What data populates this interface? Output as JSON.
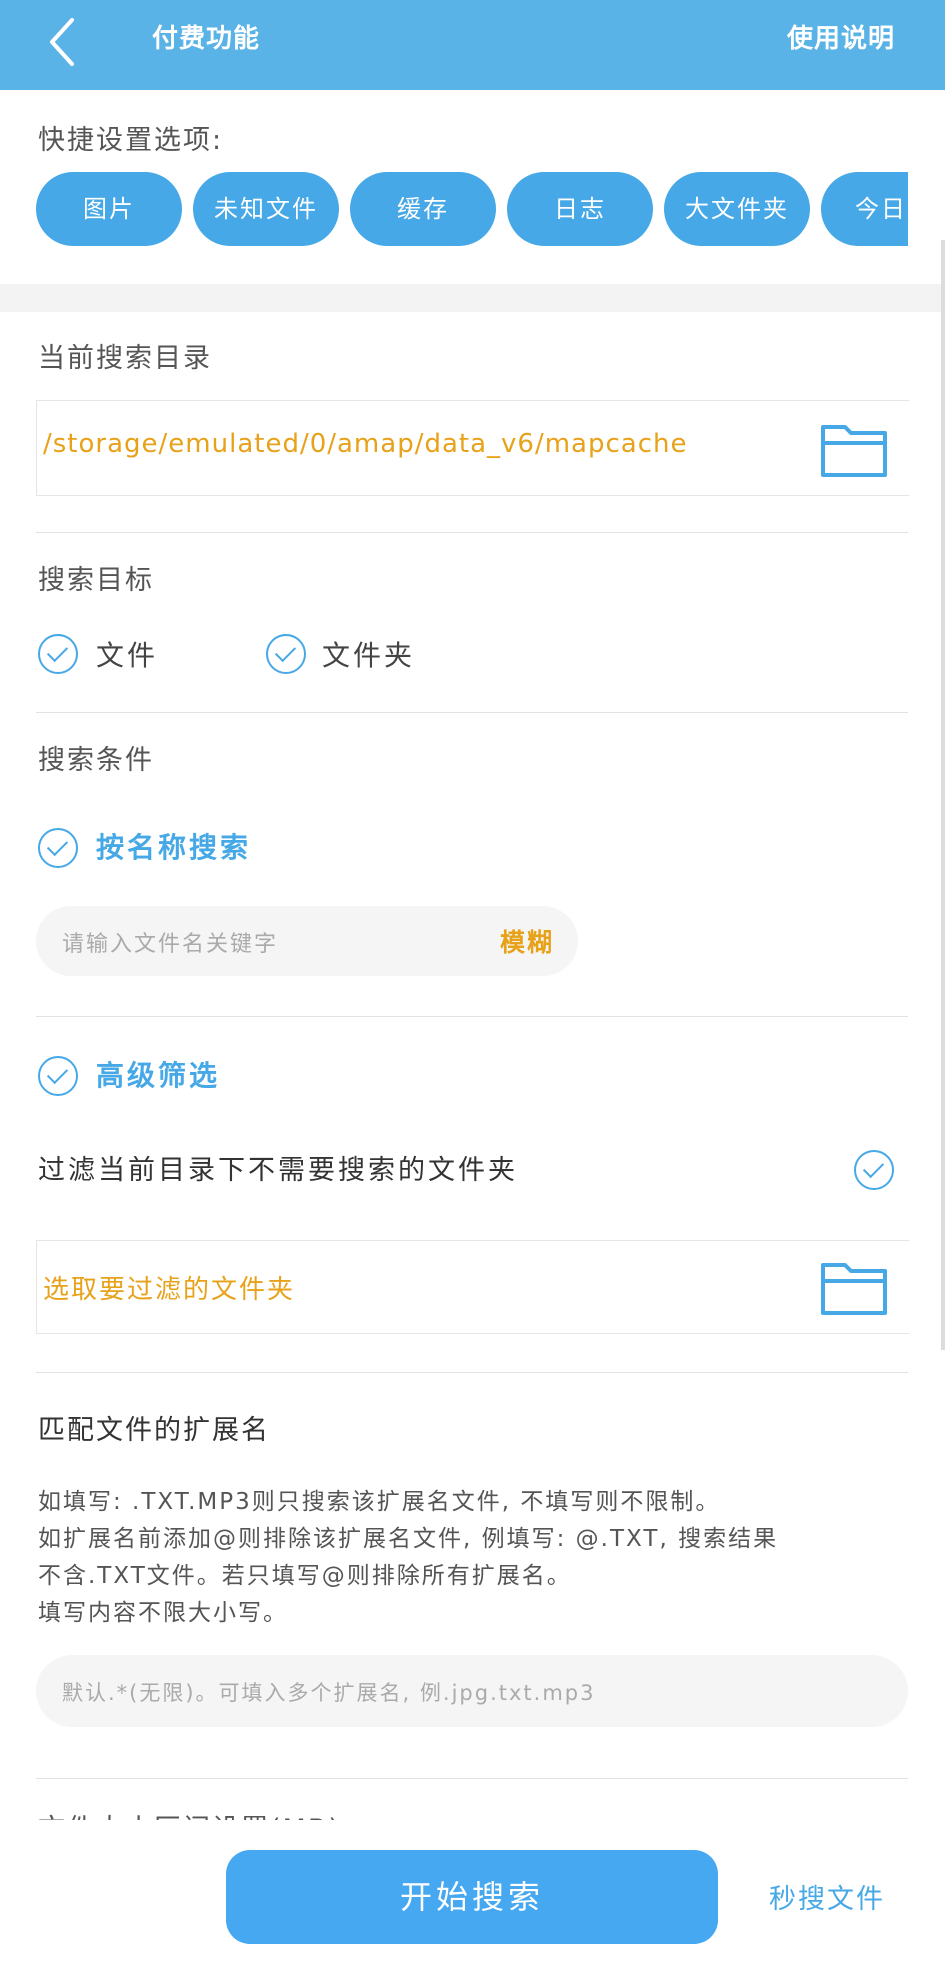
{
  "header": {
    "title": "付费功能",
    "help_label": "使用说明"
  },
  "quick_settings": {
    "title": "快捷设置选项:",
    "chips": [
      "图片",
      "未知文件",
      "缓存",
      "日志",
      "大文件夹",
      "今日文"
    ]
  },
  "search_dir": {
    "title": "当前搜索目录",
    "path": "/storage/emulated/0/amap/data_v6/mapcache"
  },
  "search_target": {
    "title": "搜索目标",
    "options": [
      {
        "label": "文件",
        "checked": true
      },
      {
        "label": "文件夹",
        "checked": true
      }
    ]
  },
  "search_conditions": {
    "title": "搜索条件",
    "by_name": {
      "label": "按名称搜索",
      "checked": true
    },
    "name_input_placeholder": "请输入文件名关键字",
    "fuzzy_label": "模糊"
  },
  "advanced_filter": {
    "label": "高级筛选",
    "checked": true,
    "filter_folders_label": "过滤当前目录下不需要搜索的文件夹",
    "filter_folders_checked": true,
    "pick_folders_label": "选取要过滤的文件夹"
  },
  "extension": {
    "title": "匹配文件的扩展名",
    "description": [
      "如填写: .TXT.MP3则只搜索该扩展名文件, 不填写则不限制。",
      "如扩展名前添加@则排除该扩展名文件, 例填写: @.TXT, 搜索结果",
      "不含.TXT文件。若只填写@则排除所有扩展名。",
      "填写内容不限大小写。"
    ],
    "input_placeholder": "默认.*(无限)。可填入多个扩展名, 例.jpg.txt.mp3"
  },
  "next_section_title": "文件大小区间设置(MB)",
  "footer": {
    "start_label": "开始搜索",
    "quick_search_label": "秒搜文件"
  },
  "colors": {
    "header_bg": "#5ab3e6",
    "accent": "#46a8e6",
    "highlight_text": "#e7a21a"
  }
}
